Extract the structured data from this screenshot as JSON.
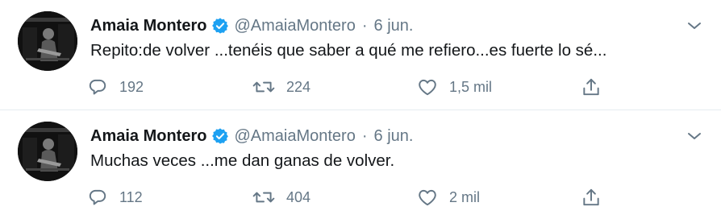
{
  "tweets": [
    {
      "author_name": "Amaia Montero",
      "handle": "@AmaiaMontero",
      "separator": "·",
      "time": "6 jun.",
      "text": "Repito:de volver ...tenéis que saber a qué me refiero...es fuerte lo sé...",
      "replies": "192",
      "retweets": "224",
      "likes": "1,5 mil"
    },
    {
      "author_name": "Amaia Montero",
      "handle": "@AmaiaMontero",
      "separator": "·",
      "time": "6 jun.",
      "text": "Muchas veces ...me dan ganas de volver.",
      "replies": "112",
      "retweets": "404",
      "likes": "2 mil"
    }
  ],
  "icons": {
    "verified": "verified-badge-icon",
    "more": "chevron-down-icon",
    "reply": "reply-icon",
    "retweet": "retweet-icon",
    "like": "heart-icon",
    "share": "share-icon"
  },
  "colors": {
    "text": "#14171a",
    "muted": "#657786",
    "verified": "#1da1f2",
    "divider": "#e6ecf0"
  }
}
